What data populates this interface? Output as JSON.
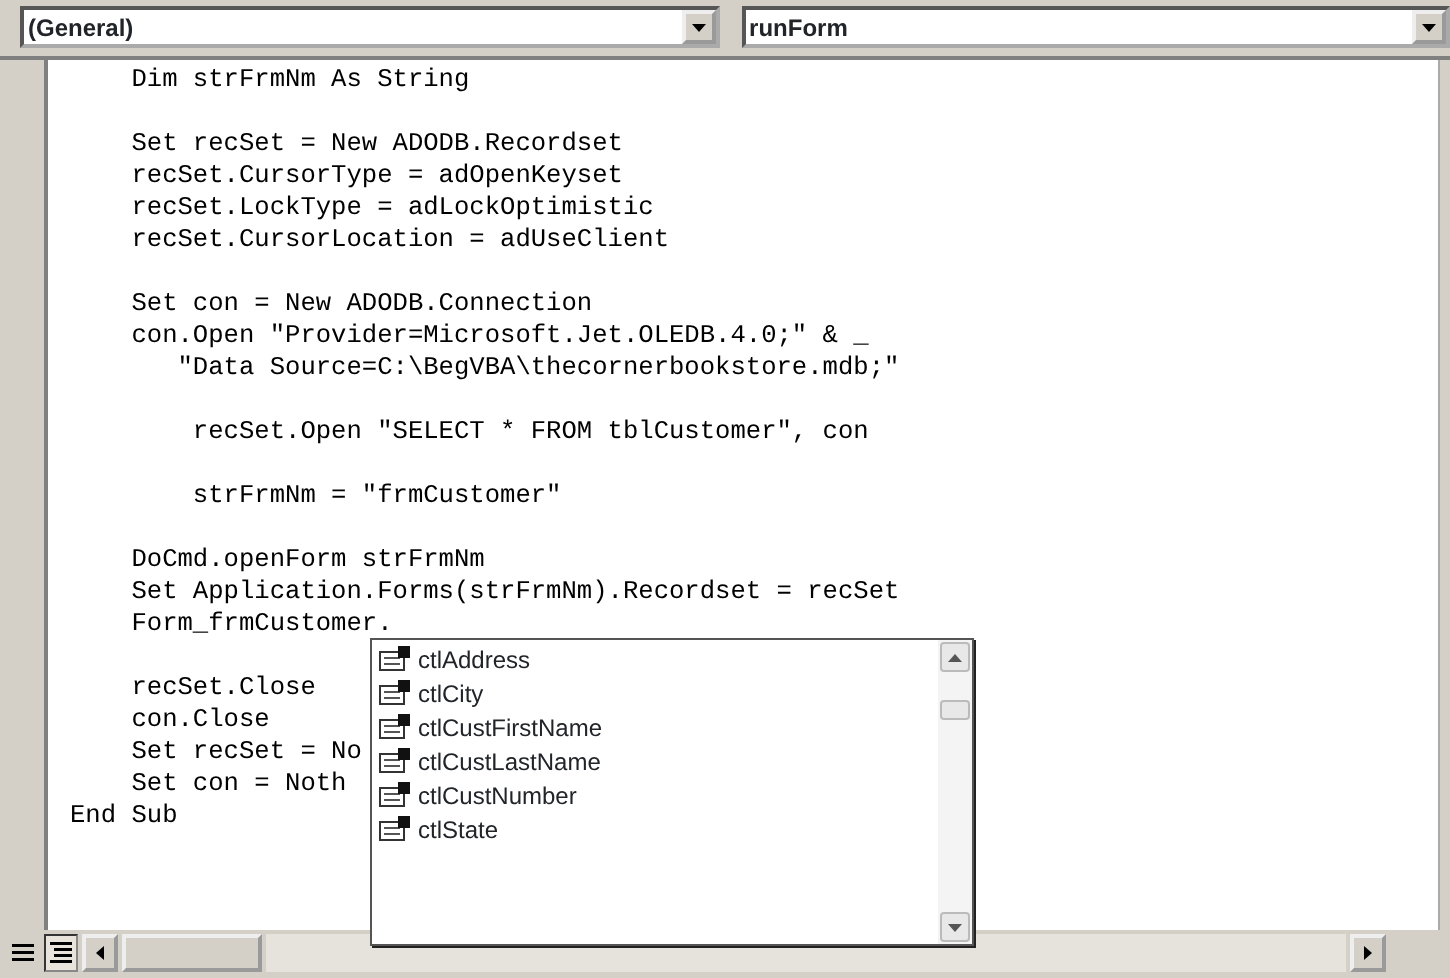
{
  "dropdowns": [
    {
      "value": "(General)"
    },
    {
      "value": "runForm"
    }
  ],
  "code_blocks": [
    [
      "    Dim strFrmNm As String"
    ],
    [
      "    Set recSet = New ADODB.Recordset",
      "    recSet.CursorType = adOpenKeyset",
      "    recSet.LockType = adLockOptimistic",
      "    recSet.CursorLocation = adUseClient"
    ],
    [
      "    Set con = New ADODB.Connection",
      "    con.Open \"Provider=Microsoft.Jet.OLEDB.4.0;\" & _",
      "       \"Data Source=C:\\BegVBA\\thecornerbookstore.mdb;\""
    ],
    [
      "        recSet.Open \"SELECT * FROM tblCustomer\", con"
    ],
    [
      "        strFrmNm = \"frmCustomer\""
    ],
    [
      "    DoCmd.openForm strFrmNm",
      "    Set Application.Forms(strFrmNm).Recordset = recSet",
      "    Form_frmCustomer."
    ],
    [
      "    recSet.Close",
      "    con.Close",
      "    Set recSet = No",
      "    Set con = Noth",
      "End Sub"
    ]
  ],
  "autocomplete": {
    "items": [
      {
        "label": "ctlAddress"
      },
      {
        "label": "ctlCity"
      },
      {
        "label": "ctlCustFirstName"
      },
      {
        "label": "ctlCustLastName"
      },
      {
        "label": "ctlCustNumber"
      },
      {
        "label": "ctlState"
      }
    ]
  }
}
